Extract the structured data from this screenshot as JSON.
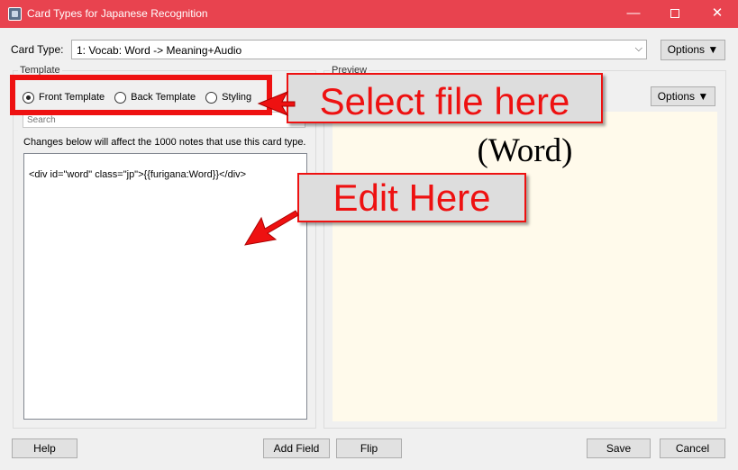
{
  "window": {
    "title": "Card Types for Japanese Recognition",
    "minimize": "—",
    "maximize": "",
    "close": "✕"
  },
  "card_type": {
    "label": "Card Type:",
    "selected": "1: Vocab: Word -> Meaning+Audio",
    "chevron": "⌵",
    "options_label": "Options ▼"
  },
  "template_group": {
    "label": "Template",
    "radios": [
      {
        "label": "Front Template",
        "checked": true
      },
      {
        "label": "Back Template",
        "checked": false
      },
      {
        "label": "Styling",
        "checked": false
      }
    ],
    "search_placeholder": "Search",
    "changes_note": "Changes below will affect the 1000 notes that use this card type.",
    "editor_content": "<div id=\"word\" class=\"jp\">{{furigana:Word}}</div>"
  },
  "preview_group": {
    "label": "Preview",
    "options_label": "Options ▼",
    "preview_text": "(Word)",
    "background": "#fffaeb"
  },
  "buttons": {
    "help": "Help",
    "add_field": "Add Field",
    "flip": "Flip",
    "save": "Save",
    "cancel": "Cancel"
  },
  "annotations": {
    "select_callout": "Select file here",
    "edit_callout": "Edit Here",
    "color": "#ee1111"
  },
  "colors": {
    "titlebar": "#e8434f",
    "window_bg": "#f0f0f0"
  }
}
